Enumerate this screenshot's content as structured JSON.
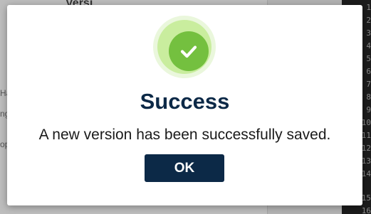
{
  "dialog": {
    "icon": "check-circle-icon",
    "title": "Success",
    "message": "A new version has been successfully saved.",
    "ok_label": "OK",
    "colors": {
      "title": "#0c2947",
      "button_bg": "#0c2947",
      "icon_green": "#74c03f"
    }
  },
  "background": {
    "title_fragment": "Versi",
    "side_fragments": [
      "Ha",
      "ng",
      "op"
    ],
    "line_numbers": [
      "1",
      "2",
      "3",
      "4",
      "5",
      "6",
      "7",
      "8",
      "9",
      "10",
      "11",
      "12",
      "13",
      "14",
      "15",
      "16"
    ]
  }
}
